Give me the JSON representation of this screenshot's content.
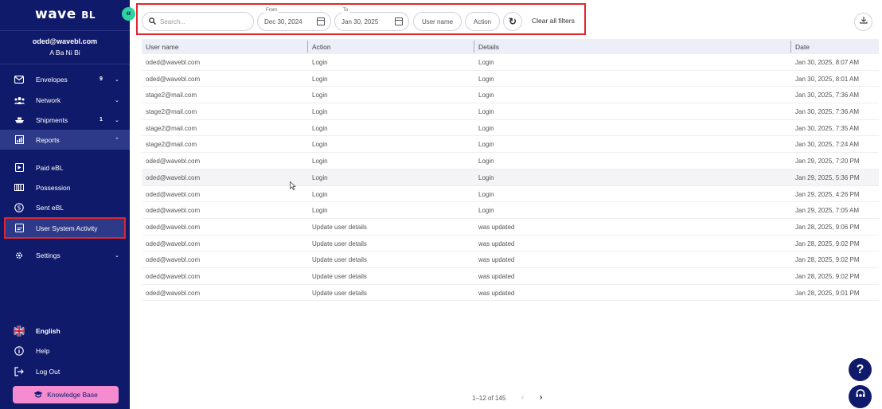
{
  "sidebar": {
    "logo": "wave",
    "logo_suffix": "BL",
    "user_email": "oded@wavebl.com",
    "user_company": "A Ba Ni Bi",
    "items": [
      {
        "label": "Envelopes",
        "count": "9",
        "icon": "envelope-icon"
      },
      {
        "label": "Network",
        "count": "",
        "icon": "network-icon"
      },
      {
        "label": "Shipments",
        "count": "1",
        "icon": "ship-icon"
      },
      {
        "label": "Reports",
        "count": "",
        "icon": "chart-icon"
      }
    ],
    "subitems": [
      {
        "label": "Paid eBL",
        "icon": "paid-icon"
      },
      {
        "label": "Possession",
        "icon": "possession-icon"
      },
      {
        "label": "Sent eBL",
        "icon": "dollar-icon"
      },
      {
        "label": "User System Activity",
        "icon": "activity-icon"
      }
    ],
    "settings_label": "Settings",
    "bottom": {
      "language": "English",
      "help": "Help",
      "logout": "Log Out",
      "knowledge_base": "Knowledge Base"
    }
  },
  "filters": {
    "search_placeholder": "Search...",
    "from_label": "From",
    "from_value": "Dec 30, 2024",
    "to_label": "To",
    "to_value": "Jan 30, 2025",
    "user_name_chip": "User name",
    "action_chip": "Action",
    "clear_all": "Clear all filters"
  },
  "table": {
    "headers": [
      "User name",
      "Action",
      "Details",
      "Date"
    ],
    "rows": [
      [
        "oded@wavebl.com",
        "Login",
        "Login",
        "Jan 30, 2025, 8:07 AM"
      ],
      [
        "oded@wavebl.com",
        "Login",
        "Login",
        "Jan 30, 2025, 8:01 AM"
      ],
      [
        "stage2@mail.com",
        "Login",
        "Login",
        "Jan 30, 2025, 7:36 AM"
      ],
      [
        "stage2@mail.com",
        "Login",
        "Login",
        "Jan 30, 2025, 7:36 AM"
      ],
      [
        "stage2@mail.com",
        "Login",
        "Login",
        "Jan 30, 2025, 7:35 AM"
      ],
      [
        "stage2@mail.com",
        "Login",
        "Login",
        "Jan 30, 2025, 7:24 AM"
      ],
      [
        "oded@wavebl.com",
        "Login",
        "Login",
        "Jan 29, 2025, 7:20 PM"
      ],
      [
        "oded@wavebl.com",
        "Login",
        "Login",
        "Jan 29, 2025, 5:36 PM"
      ],
      [
        "oded@wavebl.com",
        "Login",
        "Login",
        "Jan 29, 2025, 4:26 PM"
      ],
      [
        "oded@wavebl.com",
        "Login",
        "Login",
        "Jan 29, 2025, 7:05 AM"
      ],
      [
        "oded@wavebl.com",
        "Update user details",
        "was updated",
        "Jan 28, 2025, 9:06 PM"
      ],
      [
        "oded@wavebl.com",
        "Update user details",
        "was updated",
        "Jan 28, 2025, 9:02 PM"
      ],
      [
        "oded@wavebl.com",
        "Update user details",
        "was updated",
        "Jan 28, 2025, 9:02 PM"
      ],
      [
        "oded@wavebl.com",
        "Update user details",
        "was updated",
        "Jan 28, 2025, 9:02 PM"
      ],
      [
        "oded@wavebl.com",
        "Update user details",
        "was updated",
        "Jan 28, 2025, 9:01 PM"
      ]
    ]
  },
  "pagination": {
    "range": "1–12 of 145"
  },
  "colors": {
    "sidebar_bg": "#101a6b",
    "accent": "#2ed3a0",
    "highlight": "#e0262b",
    "kb_button": "#f58cd0"
  }
}
